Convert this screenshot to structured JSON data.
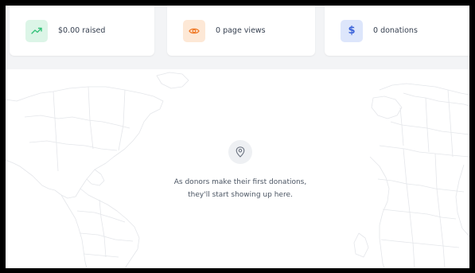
{
  "stats": {
    "raised": {
      "label": "$0.00 raised",
      "icon": "trending-up-icon",
      "accent": "#34c27a",
      "bg": "#dcf5e7"
    },
    "page_views": {
      "label": "0 page views",
      "icon": "eye-icon",
      "accent": "#f07c2b",
      "bg": "#fde8d6"
    },
    "donations": {
      "label": "0 donations",
      "icon": "dollar-icon",
      "accent": "#3b63d9",
      "bg": "#dde6fb"
    }
  },
  "map": {
    "empty_icon": "map-pin-icon",
    "empty_line_1": "As donors make their first donations,",
    "empty_line_2": "they'll start showing up here."
  }
}
